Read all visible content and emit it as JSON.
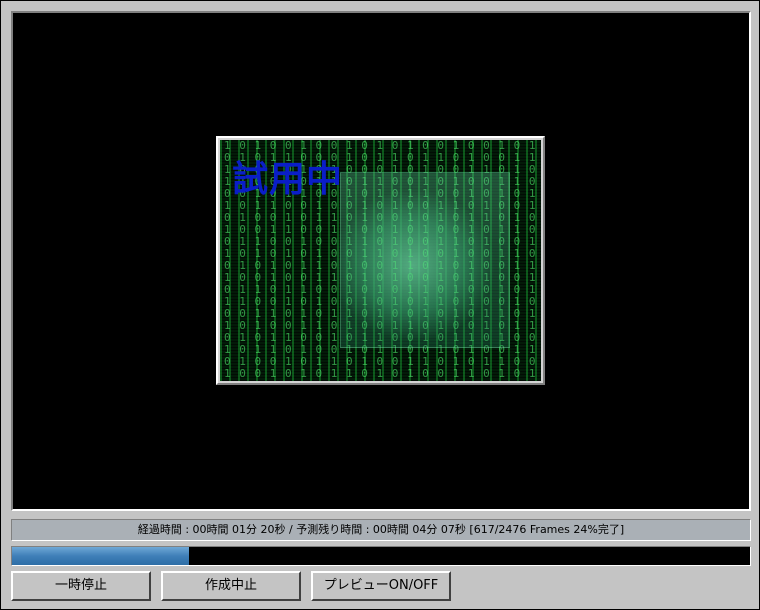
{
  "preview": {
    "trial_label": "試用中",
    "thumbnail": "matrix-style green binary code face preview"
  },
  "status": {
    "text": "経過時間 : 00時間 01分 20秒 / 予測残り時間 : 00時間 04分 07秒 [617/2476 Frames 24%完了]"
  },
  "progress": {
    "percent": 24,
    "frames_done": 617,
    "frames_total": 2476
  },
  "buttons": {
    "pause_label": "一時停止",
    "stop_label": "作成中止",
    "preview_toggle_label": "プレビューON/OFF"
  },
  "colors": {
    "progress_fill": "#3f7fb8",
    "trial_label": "#0a1ec8",
    "preview_bg": "#000000"
  }
}
